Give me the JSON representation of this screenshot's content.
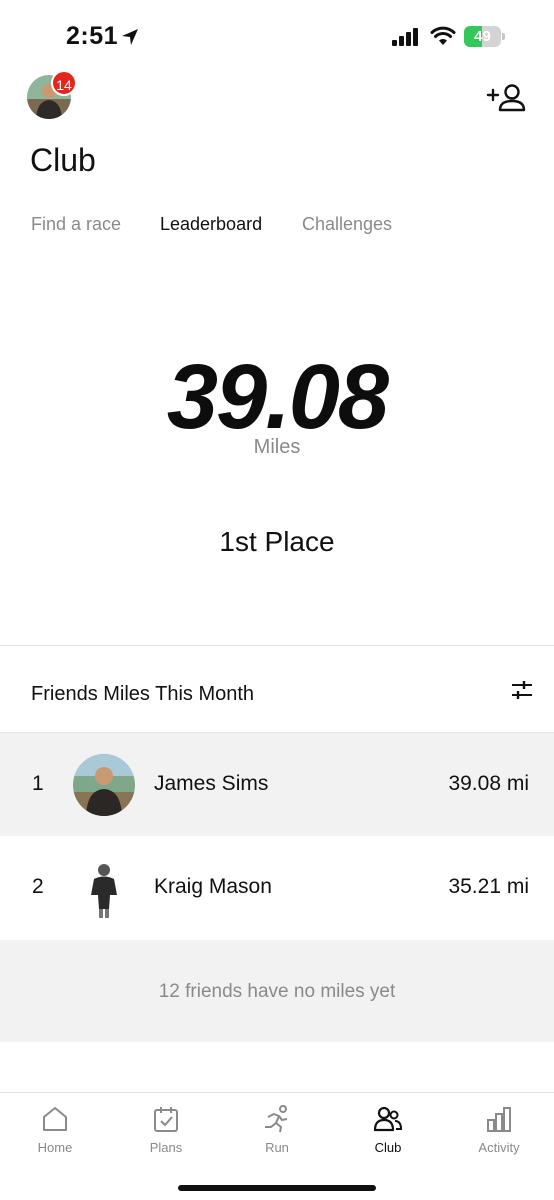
{
  "status_bar": {
    "time": "2:51",
    "battery_level": "49",
    "battery_fraction": 0.49,
    "battery_color": "#34c759",
    "icons": [
      "location-arrow-icon",
      "signal-icon",
      "wifi-icon",
      "battery-icon"
    ]
  },
  "header": {
    "notification_count": "14",
    "badge_color": "#e5261f",
    "add_friend_icon": "add-person-icon",
    "title": "Club"
  },
  "tabs": [
    {
      "label": "Find a race",
      "active": false
    },
    {
      "label": "Leaderboard",
      "active": true
    },
    {
      "label": "Challenges",
      "active": false
    }
  ],
  "hero": {
    "value": "39.08",
    "unit": "Miles",
    "place": "1st Place"
  },
  "leaderboard": {
    "title": "Friends Miles This Month",
    "filter_icon": "sliders-icon",
    "rows": [
      {
        "rank": "1",
        "name": "James Sims",
        "miles": "39.08 mi",
        "highlighted": true
      },
      {
        "rank": "2",
        "name": "Kraig Mason",
        "miles": "35.21 mi",
        "highlighted": false
      }
    ],
    "no_miles_text": "12 friends have no miles yet"
  },
  "bottom_nav": [
    {
      "label": "Home",
      "icon": "home-icon",
      "active": false
    },
    {
      "label": "Plans",
      "icon": "calendar-check-icon",
      "active": false
    },
    {
      "label": "Run",
      "icon": "runner-icon",
      "active": false
    },
    {
      "label": "Club",
      "icon": "people-icon",
      "active": true
    },
    {
      "label": "Activity",
      "icon": "bar-chart-icon",
      "active": false
    }
  ]
}
